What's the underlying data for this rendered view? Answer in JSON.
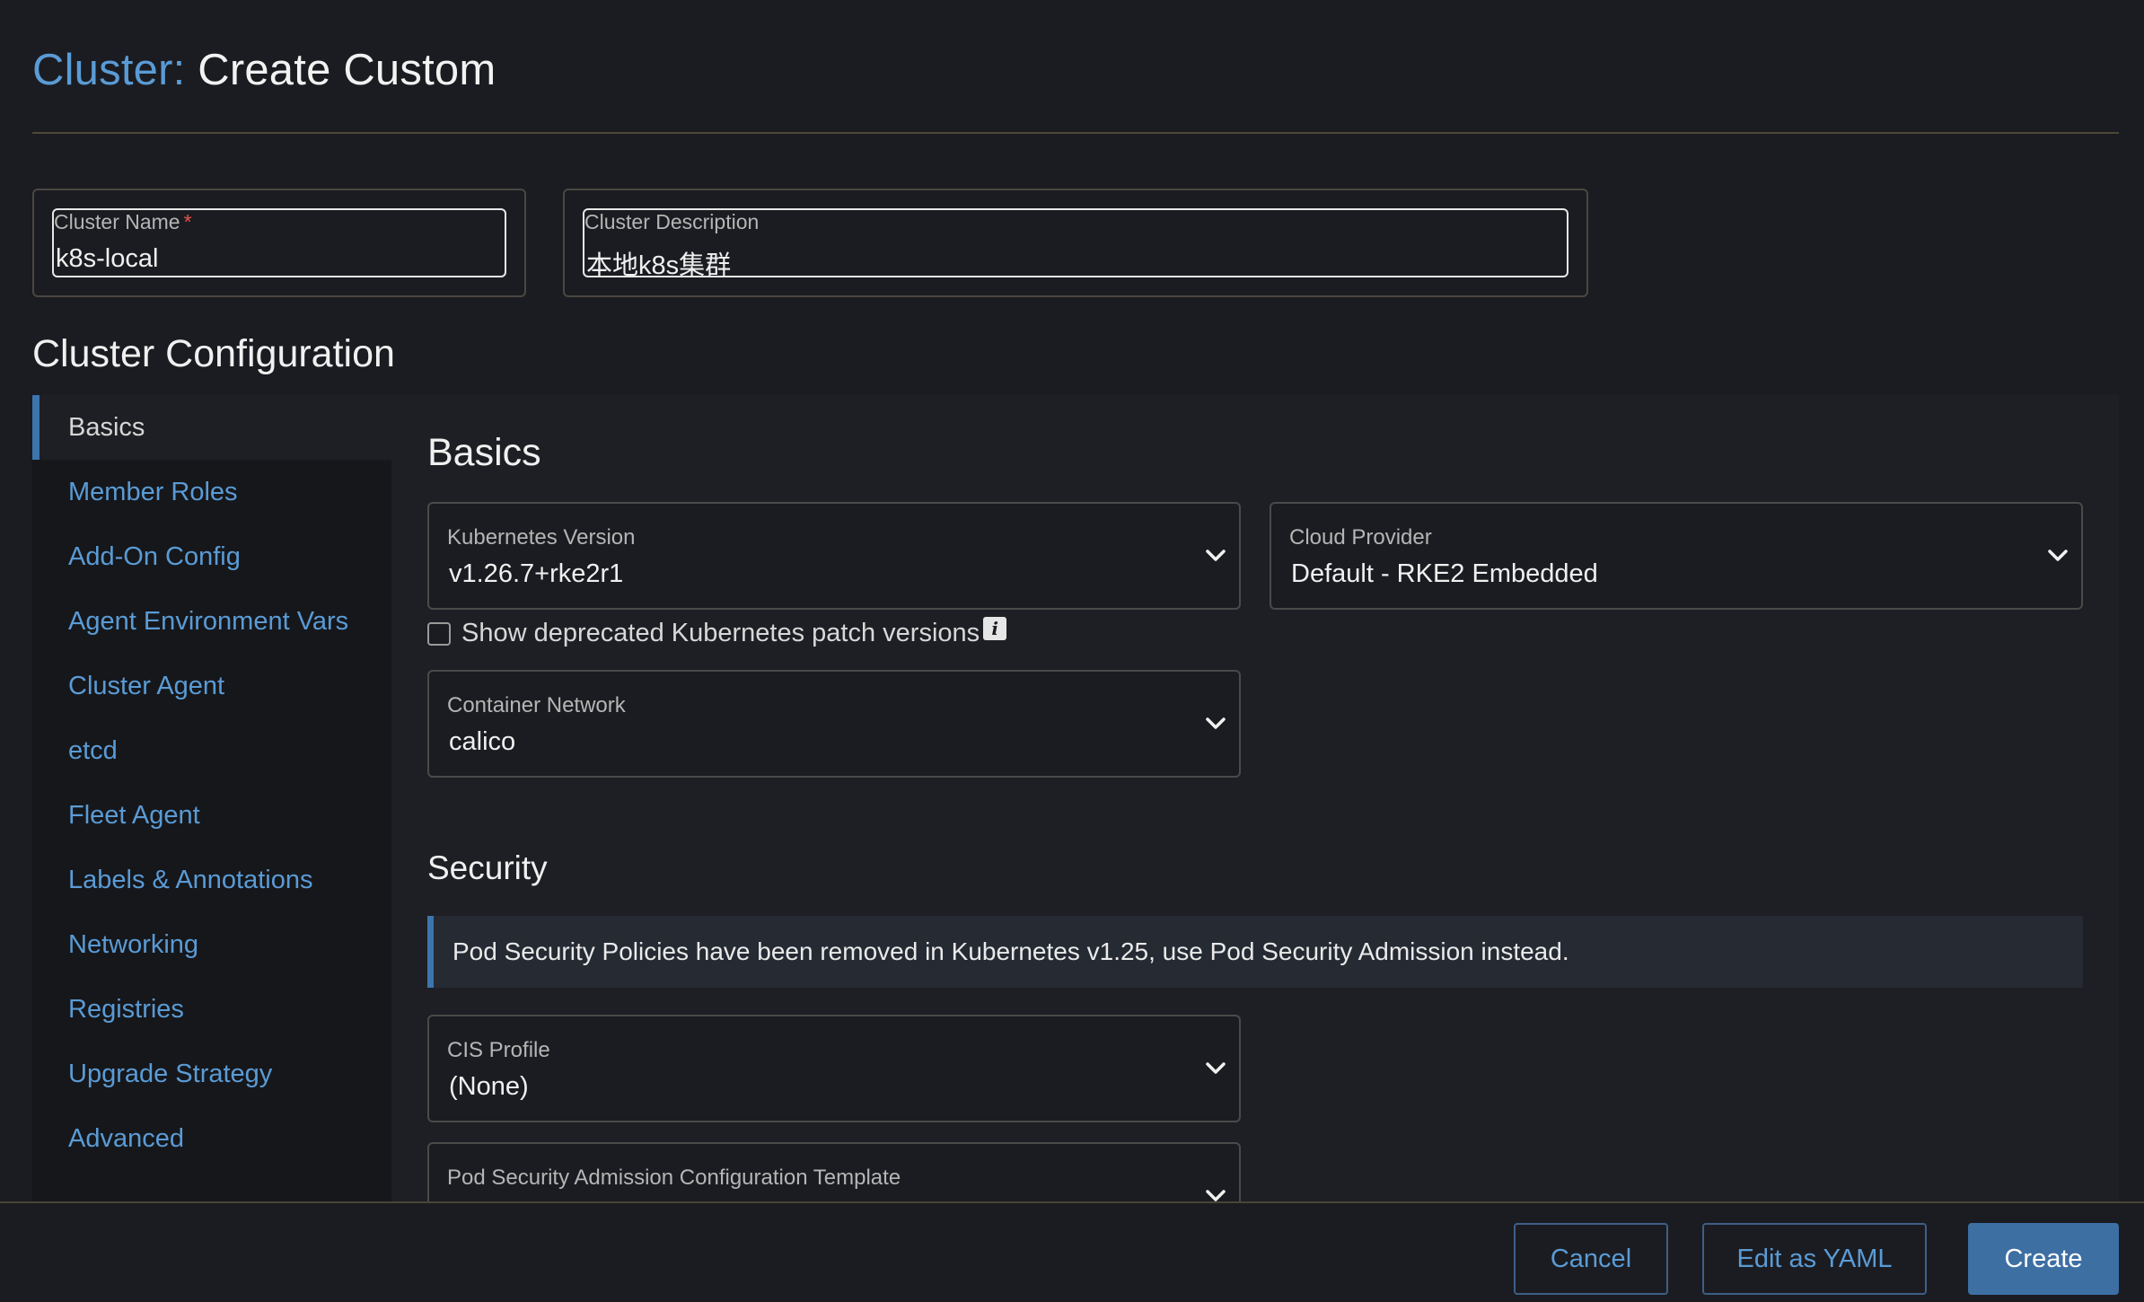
{
  "header": {
    "title_prefix": "Cluster:",
    "title_rest": "Create Custom"
  },
  "cluster_name": {
    "label": "Cluster Name",
    "required_mark": "*",
    "value": "k8s-local"
  },
  "cluster_description": {
    "label": "Cluster Description",
    "value": "本地k8s集群"
  },
  "config_title": "Cluster Configuration",
  "sidebar": {
    "items": [
      {
        "label": "Basics",
        "active": true
      },
      {
        "label": "Member Roles"
      },
      {
        "label": "Add-On Config"
      },
      {
        "label": "Agent Environment Vars"
      },
      {
        "label": "Cluster Agent"
      },
      {
        "label": "etcd"
      },
      {
        "label": "Fleet Agent"
      },
      {
        "label": "Labels & Annotations"
      },
      {
        "label": "Networking"
      },
      {
        "label": "Registries"
      },
      {
        "label": "Upgrade Strategy"
      },
      {
        "label": "Advanced"
      }
    ]
  },
  "basics": {
    "title": "Basics",
    "kubernetes_version": {
      "label": "Kubernetes Version",
      "value": "v1.26.7+rke2r1"
    },
    "cloud_provider": {
      "label": "Cloud Provider",
      "value": "Default - RKE2 Embedded"
    },
    "show_deprecated": {
      "label": "Show deprecated Kubernetes patch versions",
      "checked": false,
      "icon": "info-icon"
    },
    "container_network": {
      "label": "Container Network",
      "value": "calico"
    }
  },
  "security": {
    "title": "Security",
    "banner": "Pod Security Policies have been removed in Kubernetes v1.25, use Pod Security Admission instead.",
    "cis_profile": {
      "label": "CIS Profile",
      "value": "(None)"
    },
    "psa_template": {
      "label": "Pod Security Admission Configuration Template",
      "value": ""
    }
  },
  "footer": {
    "cancel_label": "Cancel",
    "yaml_label": "Edit as YAML",
    "create_label": "Create"
  },
  "colors": {
    "accent": "#5a9bd5",
    "primary_button": "#3d6fa3",
    "background": "#1b1c21",
    "required": "#e0564d"
  }
}
